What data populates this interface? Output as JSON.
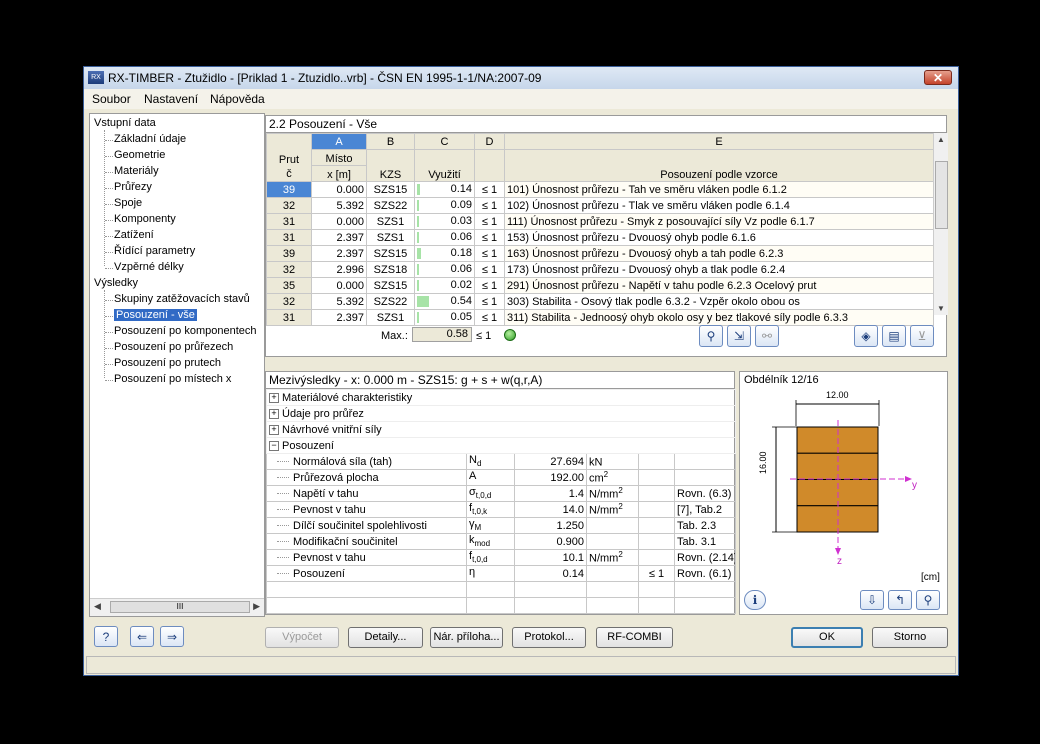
{
  "window": {
    "title": "RX-TIMBER - Ztužidlo - [Priklad 1 - Ztuzidlo..vrb] - ČSN EN 1995-1-1/NA:2007-09",
    "app_icon": "RX"
  },
  "menu": [
    "Soubor",
    "Nastavení",
    "Nápověda"
  ],
  "tree": {
    "input_root": "Vstupní data",
    "input_items": [
      "Základní údaje",
      "Geometrie",
      "Materiály",
      "Průřezy",
      "Spoje",
      "Komponenty",
      "Zatížení",
      "Řídící parametry",
      "Vzpěrné délky"
    ],
    "results_root": "Výsledky",
    "results_items": [
      "Skupiny zatěžovacích stavů",
      "Posouzení - vše",
      "Posouzení po komponentech",
      "Posouzení po průřezech",
      "Posouzení po prutech",
      "Posouzení po místech x"
    ],
    "selected": "Posouzení - vše"
  },
  "section_title": "2.2 Posouzení - Vše",
  "table": {
    "col_letters": [
      "A",
      "B",
      "C",
      "D",
      "E"
    ],
    "headers": {
      "rod": "Prut",
      "rod2": "č",
      "loc": "Místo",
      "loc2": "x [m]",
      "kzs": "KZS",
      "util": "Využití",
      "formula": "Posouzení podle vzorce"
    },
    "rows": [
      {
        "rod": "39",
        "x": "0.000",
        "kzs": "SZS15",
        "u": "0.14",
        "f": 0.14,
        "le": "≤ 1",
        "desc": "101) Únosnost průřezu - Tah ve směru vláken podle 6.1.2"
      },
      {
        "rod": "32",
        "x": "5.392",
        "kzs": "SZS22",
        "u": "0.09",
        "f": 0.09,
        "le": "≤ 1",
        "desc": "102) Únosnost průřezu - Tlak ve směru vláken podle 6.1.4"
      },
      {
        "rod": "31",
        "x": "0.000",
        "kzs": "SZS1",
        "u": "0.03",
        "f": 0.03,
        "le": "≤ 1",
        "desc": "111) Únosnost průřezu - Smyk z posouvající síly Vz podle 6.1.7"
      },
      {
        "rod": "31",
        "x": "2.397",
        "kzs": "SZS1",
        "u": "0.06",
        "f": 0.06,
        "le": "≤ 1",
        "desc": "153) Únosnost průřezu - Dvouosý ohyb podle 6.1.6"
      },
      {
        "rod": "39",
        "x": "2.397",
        "kzs": "SZS15",
        "u": "0.18",
        "f": 0.18,
        "le": "≤ 1",
        "desc": "163) Únosnost průřezu - Dvouosý ohyb a tah podle 6.2.3"
      },
      {
        "rod": "32",
        "x": "2.996",
        "kzs": "SZS18",
        "u": "0.06",
        "f": 0.06,
        "le": "≤ 1",
        "desc": "173) Únosnost průřezu - Dvouosý ohyb a tlak podle 6.2.4"
      },
      {
        "rod": "35",
        "x": "0.000",
        "kzs": "SZS15",
        "u": "0.02",
        "f": 0.02,
        "le": "≤ 1",
        "desc": "291) Únosnost průřezu - Napětí v tahu podle 6.2.3 Ocelový prut"
      },
      {
        "rod": "32",
        "x": "5.392",
        "kzs": "SZS22",
        "u": "0.54",
        "f": 0.54,
        "le": "≤ 1",
        "desc": "303) Stabilita - Osový tlak podle 6.3.2 - Vzpěr okolo obou os"
      },
      {
        "rod": "31",
        "x": "2.397",
        "kzs": "SZS1",
        "u": "0.05",
        "f": 0.05,
        "le": "≤ 1",
        "desc": "311) Stabilita - Jednoosý ohyb okolo osy y bez tlakové síly podle 6.3.3"
      }
    ],
    "max_label": "Max.:",
    "max_value": "0.58",
    "max_le": "≤ 1"
  },
  "intermediate": {
    "title": "Mezivýsledky  -  x: 0.000 m  -  SZS15: g + s + w(q,r,A)",
    "groups": [
      "Materiálové charakteristiky",
      "Údaje pro průřez",
      "Návrhové vnitřní síly",
      "Posouzení"
    ],
    "rows": [
      {
        "name": "Normálová síla (tah)",
        "sym": "N",
        "sub": "d",
        "val": "27.694",
        "unit": "kN",
        "unit_sup": "",
        "le": "",
        "ref": ""
      },
      {
        "name": "Průřezová plocha",
        "sym": "A",
        "sub": "",
        "val": "192.00",
        "unit": "cm",
        "unit_sup": "2",
        "le": "",
        "ref": ""
      },
      {
        "name": "Napětí v tahu",
        "sym": "σ",
        "sub": "t,0,d",
        "val": "1.4",
        "unit": "N/mm",
        "unit_sup": "2",
        "le": "",
        "ref": "Rovn. (6.3)"
      },
      {
        "name": "Pevnost v tahu",
        "sym": "f",
        "sub": "t,0,k",
        "val": "14.0",
        "unit": "N/mm",
        "unit_sup": "2",
        "le": "",
        "ref": "[7], Tab.2"
      },
      {
        "name": "Dílčí součinitel spolehlivosti",
        "sym": "γ",
        "sub": "M",
        "val": "1.250",
        "unit": "",
        "unit_sup": "",
        "le": "",
        "ref": "Tab. 2.3"
      },
      {
        "name": "Modifikační součinitel",
        "sym": "k",
        "sub": "mod",
        "val": "0.900",
        "unit": "",
        "unit_sup": "",
        "le": "",
        "ref": "Tab. 3.1"
      },
      {
        "name": "Pevnost v tahu",
        "sym": "f",
        "sub": "t,0,d",
        "val": "10.1",
        "unit": "N/mm",
        "unit_sup": "2",
        "le": "",
        "ref": "Rovn. (2.14)"
      },
      {
        "name": "Posouzení",
        "sym": "η",
        "sub": "",
        "val": "0.14",
        "unit": "",
        "unit_sup": "",
        "le": "≤ 1",
        "ref": "Rovn. (6.1)"
      }
    ]
  },
  "section": {
    "title": "Obdélník 12/16",
    "width_label": "12.00",
    "height_label": "16.00",
    "axis_y": "y",
    "axis_z": "z",
    "unit": "[cm]",
    "fill_color": "#d08a2a"
  },
  "buttons": {
    "calc": "Výpočet",
    "details": "Detaily...",
    "annex": "Nár. příloha...",
    "protocol": "Protokol...",
    "rfcombi": "RF-COMBI",
    "ok": "OK",
    "cancel": "Storno"
  },
  "scroll_glyph": "III"
}
